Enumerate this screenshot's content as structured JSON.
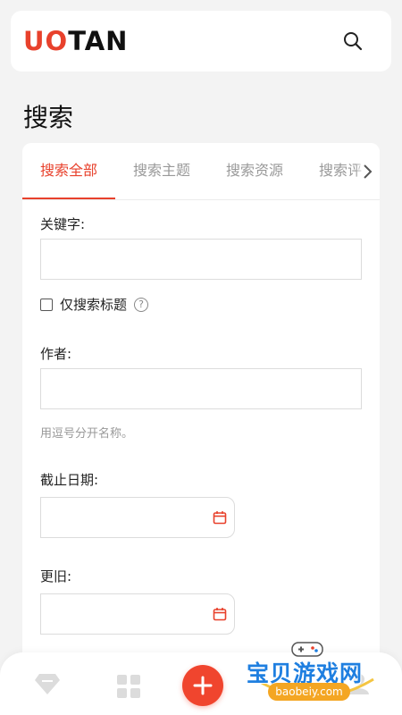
{
  "header": {
    "logo_part1": "UO",
    "logo_part2": "TAN",
    "search_icon": "search-icon"
  },
  "page": {
    "title": "搜索"
  },
  "tabs": [
    {
      "label": "搜索全部",
      "active": true
    },
    {
      "label": "搜索主题",
      "active": false
    },
    {
      "label": "搜索资源",
      "active": false
    },
    {
      "label": "搜索评",
      "active": false
    }
  ],
  "tabs_more_icon": "chevron-right-icon",
  "form": {
    "keyword_label": "关键字:",
    "keyword_value": "",
    "titles_only_label": "仅搜索标题",
    "titles_only_checked": false,
    "help_icon": "question-circle-icon",
    "author_label": "作者:",
    "author_value": "",
    "author_hint": "用逗号分开名称。",
    "date_label": "截止日期:",
    "date_value": "",
    "older_label": "更旧:",
    "older_value": "",
    "calendar_icon": "calendar-icon"
  },
  "bottom_nav": {
    "items": [
      "diamond-icon",
      "grid-icon",
      "add-icon",
      "person-icon"
    ]
  },
  "watermark": {
    "text": "宝贝游戏网",
    "url": "baobeiy.com"
  },
  "colors": {
    "accent": "#e8412c",
    "add_button": "#f0452e",
    "watermark_text": "#1f7fe0",
    "watermark_badge": "#f4a623"
  }
}
